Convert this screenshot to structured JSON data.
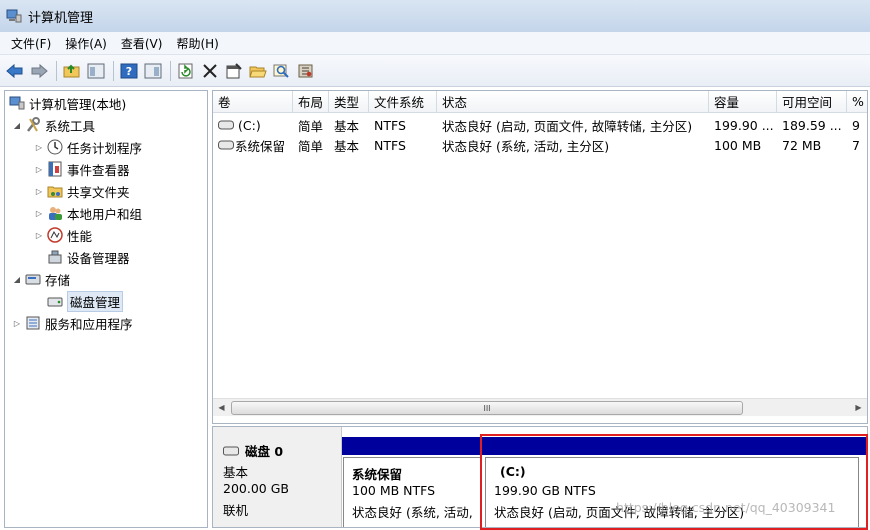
{
  "window": {
    "title": "计算机管理"
  },
  "menu": [
    "文件(F)",
    "操作(A)",
    "查看(V)",
    "帮助(H)"
  ],
  "toolbar": {
    "buttons": [
      "back-icon",
      "forward-icon",
      "up-folder-icon",
      "show-tree-icon",
      "help-icon",
      "show-pane-icon",
      "refresh-icon",
      "delete-icon",
      "properties-icon",
      "open-icon",
      "search-icon",
      "settings-icon"
    ]
  },
  "tree": {
    "root": "计算机管理(本地)",
    "system_tools": "系统工具",
    "task_scheduler": "任务计划程序",
    "event_viewer": "事件查看器",
    "shared_folders": "共享文件夹",
    "local_users": "本地用户和组",
    "performance": "性能",
    "device_manager": "设备管理器",
    "storage": "存储",
    "disk_management": "磁盘管理",
    "services": "服务和应用程序"
  },
  "volumes": {
    "headers": [
      "卷",
      "布局",
      "类型",
      "文件系统",
      "状态",
      "容量",
      "可用空间",
      "%"
    ],
    "rows": [
      {
        "name": "(C:)",
        "layout": "简单",
        "type": "基本",
        "fs": "NTFS",
        "status": "状态良好 (启动, 页面文件, 故障转储, 主分区)",
        "capacity": "199.90 ...",
        "free": "189.59 ...",
        "pct": "9"
      },
      {
        "name": "系统保留",
        "layout": "简单",
        "type": "基本",
        "fs": "NTFS",
        "status": "状态良好 (系统, 活动, 主分区)",
        "capacity": "100 MB",
        "free": "72 MB",
        "pct": "7"
      }
    ],
    "scroll_thumb": "III"
  },
  "disk": {
    "name": "磁盘 0",
    "type": "基本",
    "size": "200.00 GB",
    "state": "联机",
    "partitions": [
      {
        "name": "系统保留",
        "size": "100 MB NTFS",
        "status": "状态良好 (系统, 活动,"
      },
      {
        "name": "(C:)",
        "size": "199.90 GB NTFS",
        "status": "状态良好 (启动, 页面文件, 故障转储, 主分区)"
      }
    ]
  },
  "watermark": "https://blog.csdn.net/qq_40309341",
  "colors": {
    "partition_bar": "#00009c",
    "highlight_box": "#e02020"
  }
}
